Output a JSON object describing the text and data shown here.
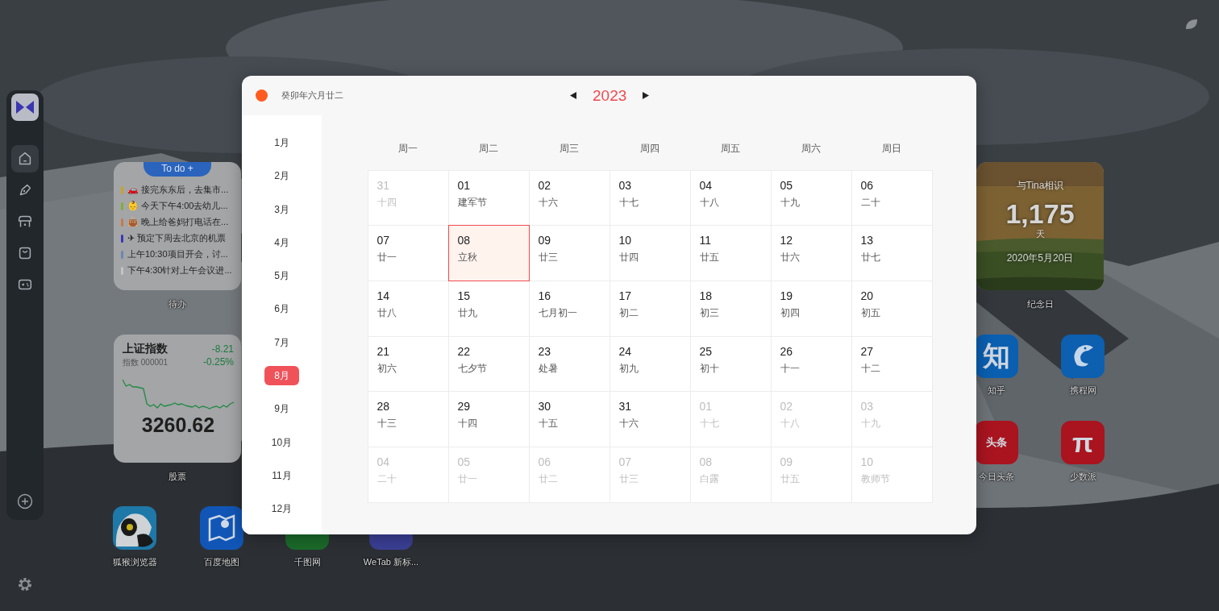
{
  "sidebar": {
    "items": [
      {
        "selected": true
      },
      {
        "selected": false
      },
      {
        "selected": false
      },
      {
        "selected": false
      },
      {
        "selected": false
      }
    ]
  },
  "todo": {
    "title": "To do +",
    "label": "待办",
    "items": [
      {
        "text": "🚗 接完东东后，去集市...",
        "color": "#c9a227"
      },
      {
        "text": "👶 今天下午4:00去幼儿...",
        "color": "#7fae3c"
      },
      {
        "text": "👜 晚上给爸妈打电话在...",
        "color": "#c7794a"
      },
      {
        "text": "✈ 预定下周去北京的机票",
        "color": "#3b35b8"
      },
      {
        "text": "上午10:30项目开会，讨...",
        "color": "#6c86b0"
      },
      {
        "text": "下午4:30针对上午会议进...",
        "color": "#c4c4c4"
      }
    ]
  },
  "stock": {
    "name": "上证指数",
    "change": "-8.21",
    "code": "指数 000001",
    "percent": "-0.25%",
    "price": "3260.62",
    "label": "股票"
  },
  "anniversary": {
    "title": "与Tina相识",
    "count": "1,175",
    "unit": "天",
    "date": "2020年5月20日",
    "label": "纪念日"
  },
  "apps": [
    {
      "name": "狐猴浏览器"
    },
    {
      "name": "百度地图"
    },
    {
      "name": "千图网"
    },
    {
      "name": "WeTab 新标..."
    },
    {
      "name": "知乎",
      "logo": "知"
    },
    {
      "name": "携程网"
    },
    {
      "name": "今日头条",
      "logo": "头条"
    },
    {
      "name": "少数派",
      "logo": "π"
    }
  ],
  "calendar": {
    "lunar_date": "癸卯年六月廿二",
    "year": "2023",
    "months": [
      {
        "label": "1月",
        "selected": false
      },
      {
        "label": "2月",
        "selected": false
      },
      {
        "label": "3月",
        "selected": false
      },
      {
        "label": "4月",
        "selected": false
      },
      {
        "label": "5月",
        "selected": false
      },
      {
        "label": "6月",
        "selected": false
      },
      {
        "label": "7月",
        "selected": false
      },
      {
        "label": "8月",
        "selected": true
      },
      {
        "label": "9月",
        "selected": false
      },
      {
        "label": "10月",
        "selected": false
      },
      {
        "label": "11月",
        "selected": false
      },
      {
        "label": "12月",
        "selected": false
      }
    ],
    "weekdays": [
      "周一",
      "周二",
      "周三",
      "周四",
      "周五",
      "周六",
      "周日"
    ],
    "days": [
      {
        "day": "31",
        "lunar": "十四",
        "current_month": false,
        "selected": false
      },
      {
        "day": "01",
        "lunar": "建军节",
        "current_month": true,
        "selected": false
      },
      {
        "day": "02",
        "lunar": "十六",
        "current_month": true,
        "selected": false
      },
      {
        "day": "03",
        "lunar": "十七",
        "current_month": true,
        "selected": false
      },
      {
        "day": "04",
        "lunar": "十八",
        "current_month": true,
        "selected": false
      },
      {
        "day": "05",
        "lunar": "十九",
        "current_month": true,
        "selected": false
      },
      {
        "day": "06",
        "lunar": "二十",
        "current_month": true,
        "selected": false
      },
      {
        "day": "07",
        "lunar": "廿一",
        "current_month": true,
        "selected": false
      },
      {
        "day": "08",
        "lunar": "立秋",
        "current_month": true,
        "selected": true
      },
      {
        "day": "09",
        "lunar": "廿三",
        "current_month": true,
        "selected": false
      },
      {
        "day": "10",
        "lunar": "廿四",
        "current_month": true,
        "selected": false
      },
      {
        "day": "11",
        "lunar": "廿五",
        "current_month": true,
        "selected": false
      },
      {
        "day": "12",
        "lunar": "廿六",
        "current_month": true,
        "selected": false
      },
      {
        "day": "13",
        "lunar": "廿七",
        "current_month": true,
        "selected": false
      },
      {
        "day": "14",
        "lunar": "廿八",
        "current_month": true,
        "selected": false
      },
      {
        "day": "15",
        "lunar": "廿九",
        "current_month": true,
        "selected": false
      },
      {
        "day": "16",
        "lunar": "七月初一",
        "current_month": true,
        "selected": false
      },
      {
        "day": "17",
        "lunar": "初二",
        "current_month": true,
        "selected": false
      },
      {
        "day": "18",
        "lunar": "初三",
        "current_month": true,
        "selected": false
      },
      {
        "day": "19",
        "lunar": "初四",
        "current_month": true,
        "selected": false
      },
      {
        "day": "20",
        "lunar": "初五",
        "current_month": true,
        "selected": false
      },
      {
        "day": "21",
        "lunar": "初六",
        "current_month": true,
        "selected": false
      },
      {
        "day": "22",
        "lunar": "七夕节",
        "current_month": true,
        "selected": false
      },
      {
        "day": "23",
        "lunar": "处暑",
        "current_month": true,
        "selected": false
      },
      {
        "day": "24",
        "lunar": "初九",
        "current_month": true,
        "selected": false
      },
      {
        "day": "25",
        "lunar": "初十",
        "current_month": true,
        "selected": false
      },
      {
        "day": "26",
        "lunar": "十一",
        "current_month": true,
        "selected": false
      },
      {
        "day": "27",
        "lunar": "十二",
        "current_month": true,
        "selected": false
      },
      {
        "day": "28",
        "lunar": "十三",
        "current_month": true,
        "selected": false
      },
      {
        "day": "29",
        "lunar": "十四",
        "current_month": true,
        "selected": false
      },
      {
        "day": "30",
        "lunar": "十五",
        "current_month": true,
        "selected": false
      },
      {
        "day": "31",
        "lunar": "十六",
        "current_month": true,
        "selected": false
      },
      {
        "day": "01",
        "lunar": "十七",
        "current_month": false,
        "selected": false
      },
      {
        "day": "02",
        "lunar": "十八",
        "current_month": false,
        "selected": false
      },
      {
        "day": "03",
        "lunar": "十九",
        "current_month": false,
        "selected": false
      },
      {
        "day": "04",
        "lunar": "二十",
        "current_month": false,
        "selected": false
      },
      {
        "day": "05",
        "lunar": "廿一",
        "current_month": false,
        "selected": false
      },
      {
        "day": "06",
        "lunar": "廿二",
        "current_month": false,
        "selected": false
      },
      {
        "day": "07",
        "lunar": "廿三",
        "current_month": false,
        "selected": false
      },
      {
        "day": "08",
        "lunar": "白露",
        "current_month": false,
        "selected": false
      },
      {
        "day": "09",
        "lunar": "廿五",
        "current_month": false,
        "selected": false
      },
      {
        "day": "10",
        "lunar": "教师节",
        "current_month": false,
        "selected": false
      }
    ]
  }
}
